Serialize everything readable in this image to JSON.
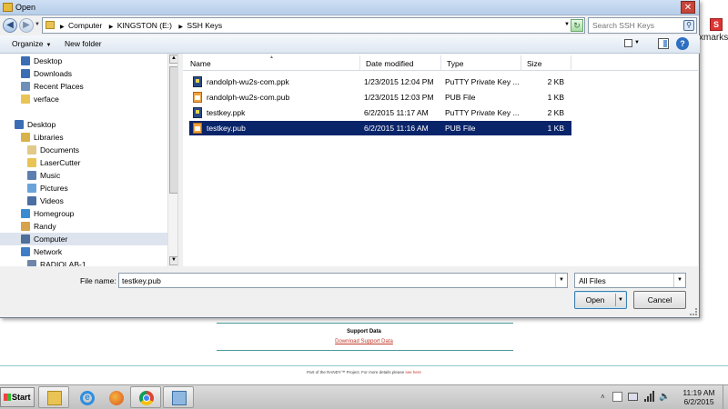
{
  "dialog": {
    "title": "Open",
    "breadcrumb": [
      "Computer",
      "KINGSTON (E:)",
      "SSH Keys"
    ],
    "search_placeholder": "Search SSH Keys",
    "toolbar": {
      "organize": "Organize",
      "new_folder": "New folder",
      "help": "?"
    }
  },
  "nav": {
    "items": [
      {
        "label": "Desktop",
        "icon": "desktop-icon",
        "indent": 2,
        "selected": false
      },
      {
        "label": "Downloads",
        "icon": "downloads-icon",
        "indent": 2,
        "selected": false
      },
      {
        "label": "Recent Places",
        "icon": "recent-places-icon",
        "indent": 2,
        "selected": false
      },
      {
        "label": "verface",
        "icon": "folder-icon",
        "indent": 2,
        "selected": false
      },
      {
        "label": "Desktop",
        "icon": "desktop-icon",
        "indent": 1,
        "selected": false
      },
      {
        "label": "Libraries",
        "icon": "libraries-icon",
        "indent": 2,
        "selected": false
      },
      {
        "label": "Documents",
        "icon": "documents-icon",
        "indent": 3,
        "selected": false
      },
      {
        "label": "LaserCutter",
        "icon": "library-folder-icon",
        "indent": 3,
        "selected": false
      },
      {
        "label": "Music",
        "icon": "music-icon",
        "indent": 3,
        "selected": false
      },
      {
        "label": "Pictures",
        "icon": "pictures-icon",
        "indent": 3,
        "selected": false
      },
      {
        "label": "Videos",
        "icon": "videos-icon",
        "indent": 3,
        "selected": false
      },
      {
        "label": "Homegroup",
        "icon": "homegroup-icon",
        "indent": 2,
        "selected": false
      },
      {
        "label": "Randy",
        "icon": "user-icon",
        "indent": 2,
        "selected": false
      },
      {
        "label": "Computer",
        "icon": "computer-icon",
        "indent": 2,
        "selected": true
      },
      {
        "label": "Network",
        "icon": "network-icon",
        "indent": 2,
        "selected": false
      },
      {
        "label": "RADIOLAB-1",
        "icon": "network-computer-icon",
        "indent": 3,
        "selected": false
      }
    ]
  },
  "columns": {
    "name": "Name",
    "date": "Date modified",
    "type": "Type",
    "size": "Size"
  },
  "files": [
    {
      "name": "randolph-wu2s-com.ppk",
      "date": "1/23/2015 12:04 PM",
      "type": "PuTTY Private Key ...",
      "size": "2 KB",
      "icon": "ppk-key-icon",
      "selected": false
    },
    {
      "name": "randolph-wu2s-com.pub",
      "date": "1/23/2015 12:03 PM",
      "type": "PUB File",
      "size": "1 KB",
      "icon": "pub-file-icon",
      "selected": false
    },
    {
      "name": "testkey.ppk",
      "date": "6/2/2015 11:17 AM",
      "type": "PuTTY Private Key ...",
      "size": "2 KB",
      "icon": "ppk-key-icon",
      "selected": false
    },
    {
      "name": "testkey.pub",
      "date": "6/2/2015 11:16 AM",
      "type": "PUB File",
      "size": "1 KB",
      "icon": "pub-file-icon",
      "selected": true
    }
  ],
  "bottom": {
    "filename_label": "File name:",
    "filename_value": "testkey.pub",
    "filetype": "All Files",
    "open": "Open",
    "cancel": "Cancel"
  },
  "background": {
    "bookmarks": "xmarks",
    "support_title": "Support Data",
    "support_link": "Download Support Data",
    "footer_text": "Part of the RANDY™ Project. For more details please",
    "footer_link": "see here"
  },
  "taskbar": {
    "start": "Start",
    "apps": [
      "file-explorer-icon",
      "internet-explorer-icon",
      "firefox-icon",
      "chrome-icon",
      "remote-desktop-icon"
    ],
    "time": "11:19 AM",
    "date": "6/2/2015"
  },
  "colors": {
    "selection": "#0a246a",
    "accent": "#2f6fc2"
  }
}
